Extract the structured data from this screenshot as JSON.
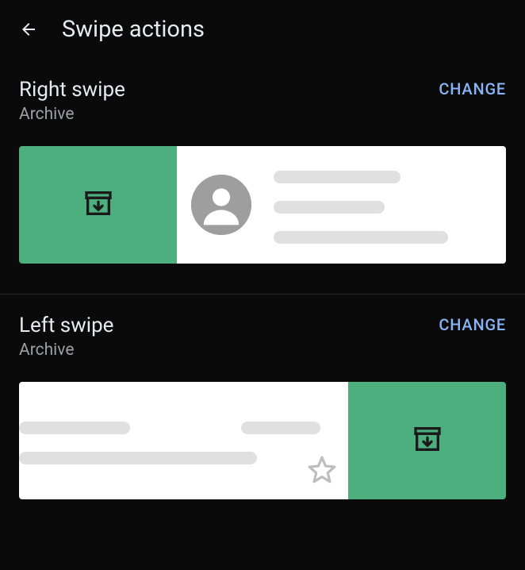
{
  "header": {
    "title": "Swipe actions"
  },
  "sections": {
    "right": {
      "title": "Right swipe",
      "subtitle": "Archive",
      "change_label": "CHANGE"
    },
    "left": {
      "title": "Left swipe",
      "subtitle": "Archive",
      "change_label": "CHANGE"
    }
  }
}
